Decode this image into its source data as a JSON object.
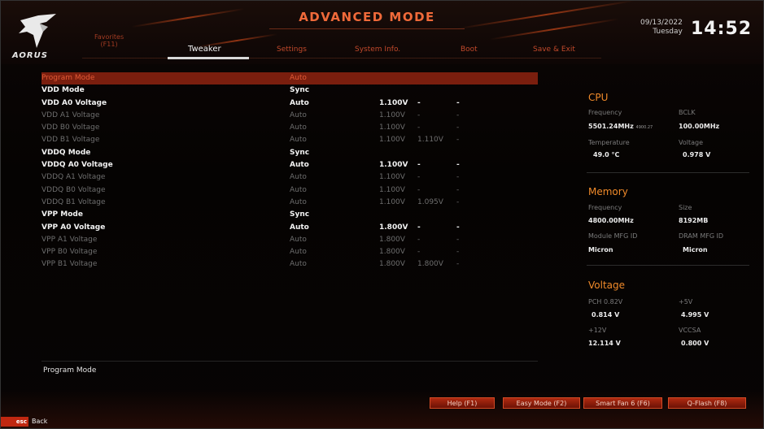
{
  "header": {
    "brand": "AORUS",
    "title": "ADVANCED MODE",
    "date": "09/13/2022",
    "day": "Tuesday",
    "time": "14:52",
    "favorites_line1": "Favorites",
    "favorites_line2": "(F11)",
    "tabs": [
      {
        "label": "Tweaker",
        "active": true
      },
      {
        "label": "Settings",
        "active": false
      },
      {
        "label": "System Info.",
        "active": false
      },
      {
        "label": "Boot",
        "active": false
      },
      {
        "label": "Save & Exit",
        "active": false
      }
    ]
  },
  "settings": [
    {
      "name": "Program Mode",
      "mode": "Auto",
      "v1": "",
      "v2": "",
      "v3": "",
      "style": "sel"
    },
    {
      "name": "VDD Mode",
      "mode": "Sync",
      "v1": "",
      "v2": "",
      "v3": "",
      "style": "bright"
    },
    {
      "name": "VDD A0 Voltage",
      "mode": "Auto",
      "v1": "1.100V",
      "v2": "-",
      "v3": "-",
      "style": "bright"
    },
    {
      "name": "VDD A1 Voltage",
      "mode": "Auto",
      "v1": "1.100V",
      "v2": "-",
      "v3": "-",
      "style": "dim"
    },
    {
      "name": "VDD B0 Voltage",
      "mode": "Auto",
      "v1": "1.100V",
      "v2": "-",
      "v3": "-",
      "style": "dim"
    },
    {
      "name": "VDD B1 Voltage",
      "mode": "Auto",
      "v1": "1.100V",
      "v2": "1.110V",
      "v3": "-",
      "style": "dim"
    },
    {
      "name": "VDDQ Mode",
      "mode": "Sync",
      "v1": "",
      "v2": "",
      "v3": "",
      "style": "bright"
    },
    {
      "name": "VDDQ A0 Voltage",
      "mode": "Auto",
      "v1": "1.100V",
      "v2": "-",
      "v3": "-",
      "style": "bright"
    },
    {
      "name": "VDDQ A1 Voltage",
      "mode": "Auto",
      "v1": "1.100V",
      "v2": "-",
      "v3": "-",
      "style": "dim"
    },
    {
      "name": "VDDQ B0 Voltage",
      "mode": "Auto",
      "v1": "1.100V",
      "v2": "-",
      "v3": "-",
      "style": "dim"
    },
    {
      "name": "VDDQ B1 Voltage",
      "mode": "Auto",
      "v1": "1.100V",
      "v2": "1.095V",
      "v3": "-",
      "style": "dim"
    },
    {
      "name": "VPP Mode",
      "mode": "Sync",
      "v1": "",
      "v2": "",
      "v3": "",
      "style": "bright"
    },
    {
      "name": "VPP A0 Voltage",
      "mode": "Auto",
      "v1": "1.800V",
      "v2": "-",
      "v3": "-",
      "style": "bright"
    },
    {
      "name": "VPP A1 Voltage",
      "mode": "Auto",
      "v1": "1.800V",
      "v2": "-",
      "v3": "-",
      "style": "dim"
    },
    {
      "name": "VPP B0 Voltage",
      "mode": "Auto",
      "v1": "1.800V",
      "v2": "-",
      "v3": "-",
      "style": "dim"
    },
    {
      "name": "VPP B1 Voltage",
      "mode": "Auto",
      "v1": "1.800V",
      "v2": "1.800V",
      "v3": "-",
      "style": "dim"
    }
  ],
  "cpu": {
    "title": "CPU",
    "frequency_label": "Frequency",
    "bclk_label": "BCLK",
    "frequency": "5501.24MHz",
    "frequency_sub": "4900.27",
    "bclk": "100.00MHz",
    "temperature_label": "Temperature",
    "voltage_label": "Voltage",
    "temperature": "49.0 °C",
    "voltage": "0.978 V"
  },
  "memory": {
    "title": "Memory",
    "frequency_label": "Frequency",
    "size_label": "Size",
    "frequency": "4800.00MHz",
    "size": "8192MB",
    "module_label": "Module MFG ID",
    "dram_label": "DRAM MFG ID",
    "module": "Micron",
    "dram": "Micron"
  },
  "voltage": {
    "title": "Voltage",
    "pch_label": "PCH 0.82V",
    "p5v_label": "+5V",
    "pch": "0.814 V",
    "p5v": "4.995 V",
    "p12v_label": "+12V",
    "vccsa_label": "VCCSA",
    "p12v": "12.114 V",
    "vccsa": "0.800 V"
  },
  "help_text": "Program Mode",
  "buttons": [
    {
      "label": "Help (F1)"
    },
    {
      "label": "Easy Mode (F2)"
    },
    {
      "label": "Smart Fan 6 (F6)"
    },
    {
      "label": "Q-Flash (F8)"
    }
  ],
  "esc": {
    "key": "esc",
    "label": "Back"
  },
  "colors": {
    "accent": "#f06a3a",
    "selected_row": "#7a1e0e",
    "section_title": "#f08a2a"
  }
}
